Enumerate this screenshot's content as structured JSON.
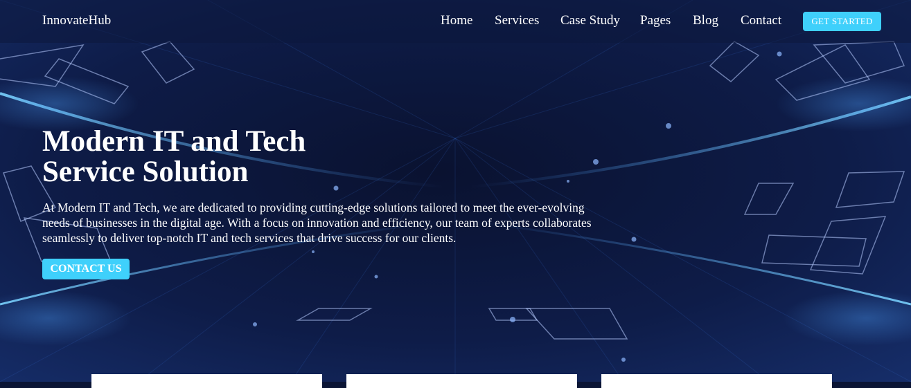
{
  "nav": {
    "brand": "InnovateHub",
    "links": [
      "Home",
      "Services",
      "Case Study",
      "Pages",
      "Blog",
      "Contact"
    ],
    "cta_label": "GET STARTED"
  },
  "hero": {
    "title_line1": "Modern IT and Tech",
    "title_line2": "Service Solution",
    "description": "At Modern IT and Tech, we are dedicated to providing cutting-edge solutions tailored to meet the ever-evolving needs of businesses in the digital age. With a focus on innovation and efficiency, our team of experts collaborates seamlessly to deliver top-notch IT and tech services that drive success for our clients.",
    "cta_label": "CONTACT US"
  },
  "colors": {
    "accent": "#3fd0fb",
    "background": "#0b1535",
    "text": "#ffffff"
  }
}
